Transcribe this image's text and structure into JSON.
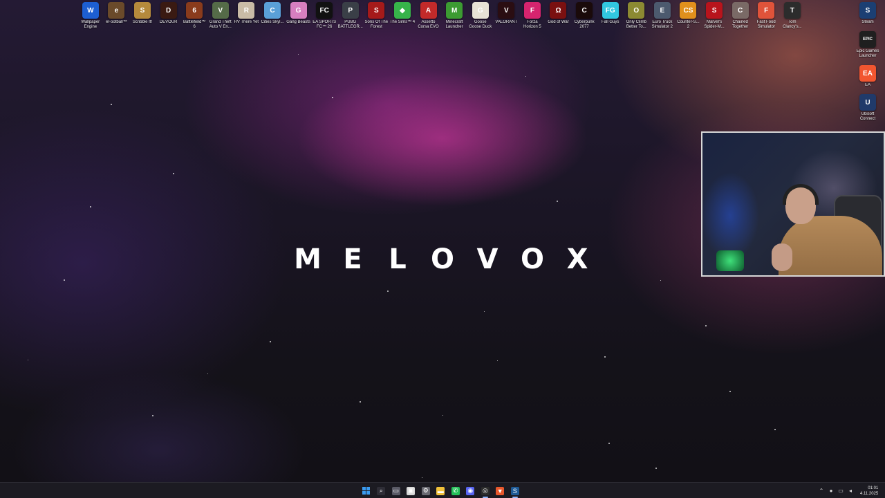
{
  "desktop_icons": [
    {
      "label": "Wallpaper Engine",
      "icon": "wallpaper-engine-icon",
      "color": "#1d5fd1",
      "glyph": "W"
    },
    {
      "label": "eFootball™",
      "icon": "efootball-icon",
      "color": "#6a4a2a",
      "glyph": "e"
    },
    {
      "label": "Scribble It!",
      "icon": "scribble-it-icon",
      "color": "#b58a3c",
      "glyph": "S"
    },
    {
      "label": "DEVOUR",
      "icon": "devour-icon",
      "color": "#3a1a12",
      "glyph": "D"
    },
    {
      "label": "Battlefield™ 6",
      "icon": "battlefield-6-icon",
      "color": "#8a3b1c",
      "glyph": "6"
    },
    {
      "label": "Grand Theft Auto V En...",
      "icon": "gta-v-icon",
      "color": "#556b48",
      "glyph": "V"
    },
    {
      "label": "RV There Yet",
      "icon": "rv-there-yet-icon",
      "color": "#c9bba6",
      "glyph": "R"
    },
    {
      "label": "Cities Skyl...",
      "icon": "cities-skylines-icon",
      "color": "#5aa0d8",
      "glyph": "C"
    },
    {
      "label": "Gang Beasts",
      "icon": "gang-beasts-icon",
      "color": "#d77fc0",
      "glyph": "G"
    },
    {
      "label": "EA SPORTS FC™ 26",
      "icon": "ea-sports-fc-icon",
      "color": "#111111",
      "glyph": "FC"
    },
    {
      "label": "PUBG BATTLEGR...",
      "icon": "pubg-icon",
      "color": "#3a3f47",
      "glyph": "P"
    },
    {
      "label": "Sons Of The Forest",
      "icon": "sons-of-the-forest-icon",
      "color": "#a51a1a",
      "glyph": "S"
    },
    {
      "label": "The Sims™ 4",
      "icon": "the-sims-4-icon",
      "color": "#37b34a",
      "glyph": "◆"
    },
    {
      "label": "Assetto Corsa EVO",
      "icon": "assetto-corsa-evo-icon",
      "color": "#c22a2a",
      "glyph": "A"
    },
    {
      "label": "Minecraft Launcher",
      "icon": "minecraft-launcher-icon",
      "color": "#3c9b32",
      "glyph": "M"
    },
    {
      "label": "Goose Goose Duck",
      "icon": "goose-goose-duck-icon",
      "color": "#e8e2d6",
      "glyph": "G"
    },
    {
      "label": "VALORANT",
      "icon": "valorant-icon",
      "color": "#2a0d12",
      "glyph": "V"
    },
    {
      "label": "Forza Horizon 5",
      "icon": "forza-horizon-5-icon",
      "color": "#d6246e",
      "glyph": "F"
    },
    {
      "label": "God of War",
      "icon": "god-of-war-icon",
      "color": "#7a1010",
      "glyph": "Ω"
    },
    {
      "label": "Cyberpunk 2077",
      "icon": "cyberpunk-2077-icon",
      "color": "#1a0a0a",
      "glyph": "C"
    },
    {
      "label": "Fall Guys",
      "icon": "fall-guys-icon",
      "color": "#31c7e0",
      "glyph": "FG"
    },
    {
      "label": "Only Climb Better To...",
      "icon": "only-climb-icon",
      "color": "#8c8a32",
      "glyph": "O"
    },
    {
      "label": "Euro Truck Simulator 2",
      "icon": "euro-truck-simulator-2-icon",
      "color": "#4c5a6e",
      "glyph": "E"
    },
    {
      "label": "Counter-S... 2",
      "icon": "counter-strike-2-icon",
      "color": "#e0901c",
      "glyph": "CS"
    },
    {
      "label": "Marvel's Spider-M...",
      "icon": "spider-man-icon",
      "color": "#b8141c",
      "glyph": "S"
    },
    {
      "label": "Chained Together",
      "icon": "chained-together-icon",
      "color": "#7a6a66",
      "glyph": "C"
    },
    {
      "label": "Fast Food Simulator",
      "icon": "fast-food-simulator-icon",
      "color": "#e0533a",
      "glyph": "F"
    },
    {
      "label": "Tom Clancy's...",
      "icon": "tom-clancys-icon",
      "color": "#2c2c2c",
      "glyph": "T"
    }
  ],
  "right_icons": [
    {
      "label": "Steam",
      "icon": "steam-icon",
      "color": "#1b3f73",
      "glyph": "S"
    },
    {
      "label": "Epic Games Launcher",
      "icon": "epic-games-launcher-icon",
      "color": "#1f1f1f",
      "glyph": "EPIC"
    },
    {
      "label": "EA",
      "icon": "ea-app-icon",
      "color": "#f25630",
      "glyph": "EA"
    },
    {
      "label": "Ubisoft Connect",
      "icon": "ubisoft-connect-icon",
      "color": "#203a6a",
      "glyph": "U"
    }
  ],
  "brand": {
    "letters": [
      "M",
      "E",
      "L",
      "O",
      "V",
      "O",
      "X"
    ]
  },
  "taskbar": {
    "buttons": [
      {
        "name": "start-button",
        "icon": "windows-logo-icon",
        "color": "#3a9bf0",
        "glyph": "",
        "active": false
      },
      {
        "name": "search-button",
        "icon": "search-icon",
        "color": "#2e2d36",
        "glyph": "⌕",
        "active": false
      },
      {
        "name": "task-view-button",
        "icon": "task-view-icon",
        "color": "#5a5a66",
        "glyph": "▭",
        "active": false
      },
      {
        "name": "widgets-button",
        "icon": "widgets-icon",
        "color": "#d7d7d7",
        "glyph": "▣",
        "active": false
      },
      {
        "name": "settings-button",
        "icon": "gear-icon",
        "color": "#6a6a72",
        "glyph": "⚙",
        "active": false
      },
      {
        "name": "file-explorer-button",
        "icon": "folder-icon",
        "color": "#f2c23a",
        "glyph": "▬",
        "active": false
      },
      {
        "name": "whatsapp-button",
        "icon": "whatsapp-icon",
        "color": "#25c25a",
        "glyph": "✆",
        "active": false
      },
      {
        "name": "discord-button",
        "icon": "discord-icon",
        "color": "#5865f2",
        "glyph": "◉",
        "active": false
      },
      {
        "name": "obs-button",
        "icon": "obs-icon",
        "color": "#2b2b2b",
        "glyph": "◎",
        "active": true
      },
      {
        "name": "brave-button",
        "icon": "brave-browser-icon",
        "color": "#e8582c",
        "glyph": "▼",
        "active": false
      },
      {
        "name": "steam-taskbar-button",
        "icon": "steam-icon",
        "color": "#1e5a96",
        "glyph": "S",
        "active": true
      }
    ],
    "tray": {
      "icons": [
        "chevron-up-icon",
        "microphone-icon",
        "display-icon",
        "speaker-icon"
      ],
      "time": "01:01",
      "date": "4.11.2025"
    }
  }
}
